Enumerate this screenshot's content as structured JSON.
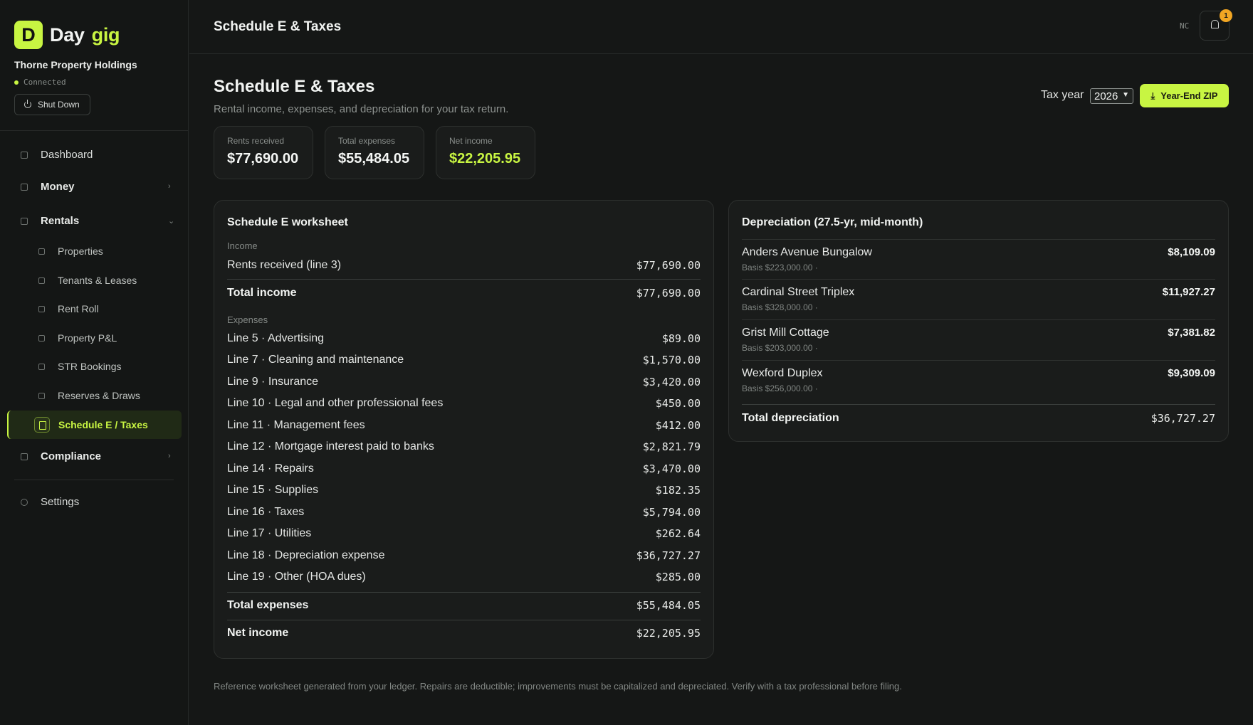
{
  "brand": {
    "logo_letter": "D",
    "name": "Day",
    "accent": "gig",
    "accent_color": "#c8f542"
  },
  "org": {
    "name": "Thorne Property Holdings",
    "status": "Connected",
    "shutdown_label": "Shut Down"
  },
  "nav": {
    "dashboard": "Dashboard",
    "money": "Money",
    "rentals": "Rentals",
    "rentals_sub": [
      "Properties",
      "Tenants & Leases",
      "Rent Roll",
      "Property P&L",
      "STR Bookings",
      "Reserves & Draws"
    ],
    "active": "Schedule E / Taxes",
    "compliance": "Compliance",
    "settings": "Settings"
  },
  "topbar": {
    "title": "Schedule E & Taxes",
    "user_initials": "NC",
    "notification_count": "1"
  },
  "page": {
    "title": "Schedule E & Taxes",
    "subtitle": "Rental income, expenses, and depreciation for your tax return.",
    "tax_year_label": "Tax year",
    "tax_year_value": "2026",
    "zip_button": "Year-End ZIP"
  },
  "stats": [
    {
      "label": "Rents received",
      "value": "$77,690.00"
    },
    {
      "label": "Total expenses",
      "value": "$55,484.05"
    },
    {
      "label": "Net income",
      "value": "$22,205.95"
    }
  ],
  "worksheet": {
    "title": "Schedule E worksheet",
    "income_label": "Income",
    "income_row": {
      "label": "Rents received (line 3)",
      "amount": "$77,690.00"
    },
    "total_income": {
      "label": "Total income",
      "amount": "$77,690.00"
    },
    "expenses_label": "Expenses",
    "expenses": [
      {
        "label": "Line 5 · Advertising",
        "amount": "$89.00"
      },
      {
        "label": "Line 7 · Cleaning and maintenance",
        "amount": "$1,570.00"
      },
      {
        "label": "Line 9 · Insurance",
        "amount": "$3,420.00"
      },
      {
        "label": "Line 10 · Legal and other professional fees",
        "amount": "$450.00"
      },
      {
        "label": "Line 11 · Management fees",
        "amount": "$412.00"
      },
      {
        "label": "Line 12 · Mortgage interest paid to banks",
        "amount": "$2,821.79"
      },
      {
        "label": "Line 14 · Repairs",
        "amount": "$3,470.00"
      },
      {
        "label": "Line 15 · Supplies",
        "amount": "$182.35"
      },
      {
        "label": "Line 16 · Taxes",
        "amount": "$5,794.00"
      },
      {
        "label": "Line 17 · Utilities",
        "amount": "$262.64"
      },
      {
        "label": "Line 18 · Depreciation expense",
        "amount": "$36,727.27"
      },
      {
        "label": "Line 19 · Other (HOA dues)",
        "amount": "$285.00"
      }
    ],
    "total_expenses": {
      "label": "Total expenses",
      "amount": "$55,484.05"
    },
    "net_income": {
      "label": "Net income",
      "amount": "$22,205.95"
    }
  },
  "depreciation": {
    "title": "Depreciation (27.5-yr, mid-month)",
    "items": [
      {
        "name": "Anders Avenue Bungalow",
        "basis": "Basis $223,000.00 ·",
        "amount": "$8,109.09"
      },
      {
        "name": "Cardinal Street Triplex",
        "basis": "Basis $328,000.00 ·",
        "amount": "$11,927.27"
      },
      {
        "name": "Grist Mill Cottage",
        "basis": "Basis $203,000.00 ·",
        "amount": "$7,381.82"
      },
      {
        "name": "Wexford Duplex",
        "basis": "Basis $256,000.00 ·",
        "amount": "$9,309.09"
      }
    ],
    "total": {
      "label": "Total depreciation",
      "amount": "$36,727.27"
    }
  },
  "footnote": "Reference worksheet generated from your ledger. Repairs are deductible; improvements must be capitalized and depreciated. Verify with a tax professional before filing."
}
